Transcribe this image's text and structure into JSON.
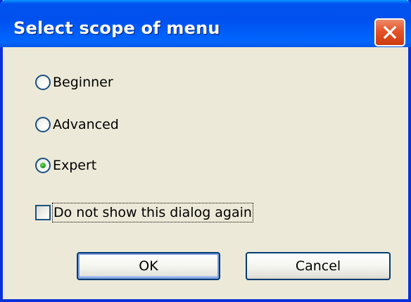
{
  "dialog": {
    "title": "Select scope of menu",
    "close_icon": "close-icon"
  },
  "options": [
    {
      "label": "Beginner",
      "selected": false
    },
    {
      "label": "Advanced",
      "selected": false
    },
    {
      "label": "Expert",
      "selected": true
    }
  ],
  "checkbox": {
    "label": "Do not show this dialog again",
    "checked": false
  },
  "buttons": {
    "ok_label": "OK",
    "cancel_label": "Cancel"
  },
  "colors": {
    "titlebar": "#0053ee",
    "window_bg": "#ece9d8",
    "close_button": "#e4542a",
    "radio_selected_dot": "#21a121"
  }
}
